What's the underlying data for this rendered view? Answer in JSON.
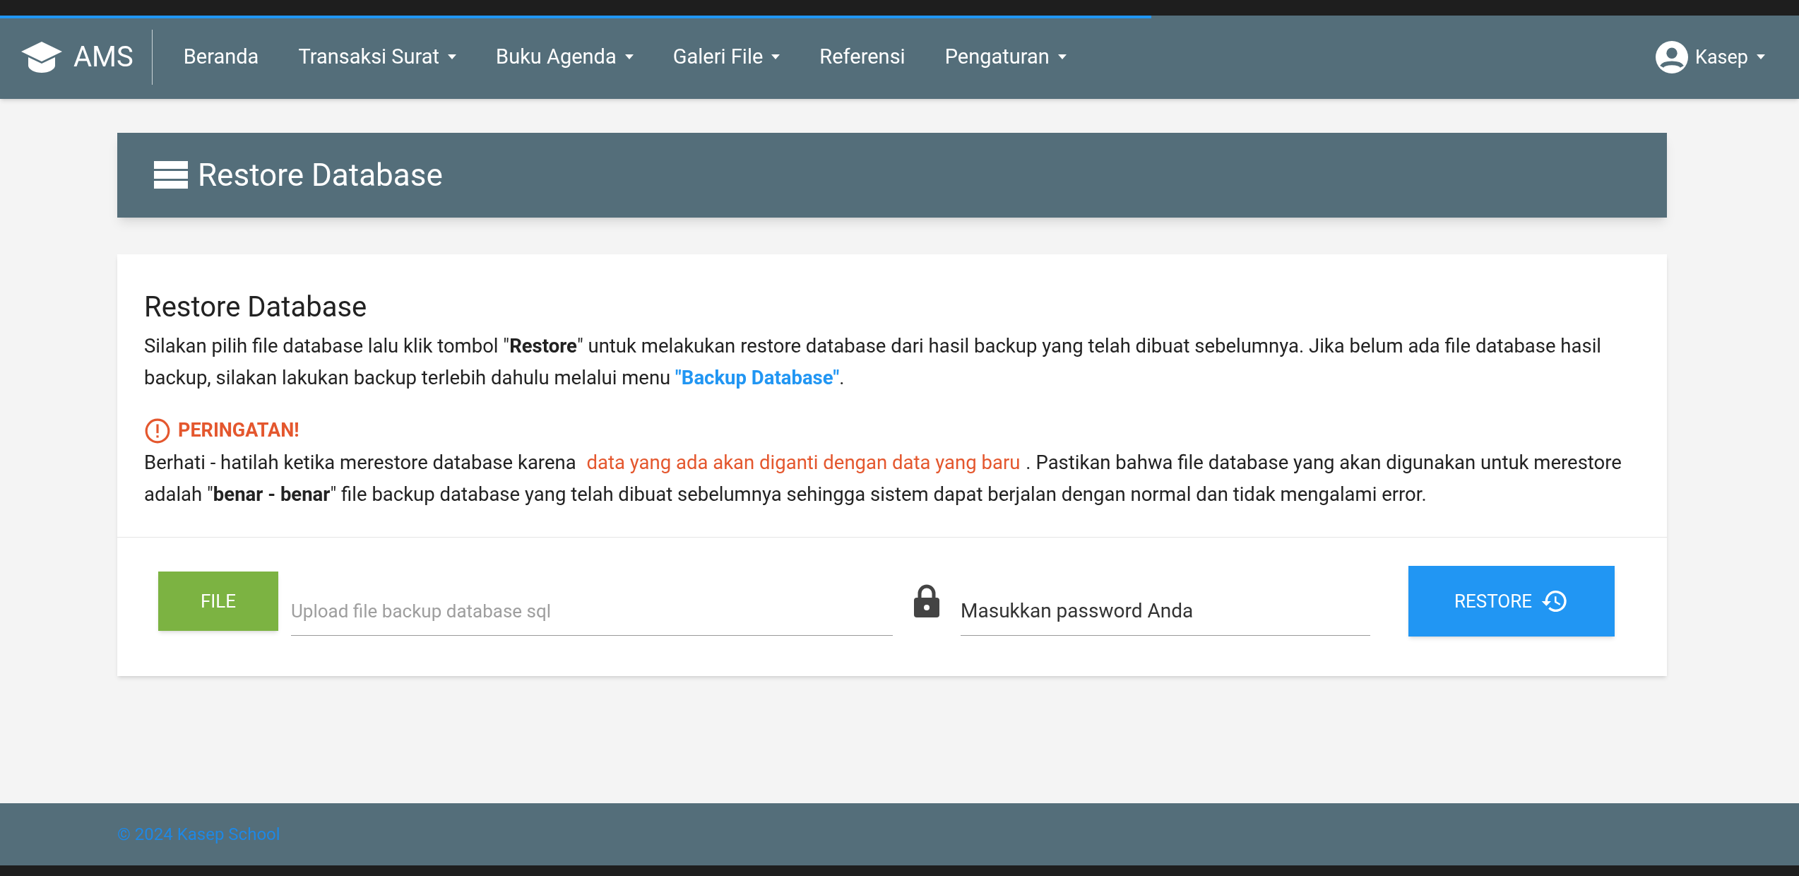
{
  "navbar": {
    "brand": "AMS",
    "items": [
      {
        "label": "Beranda",
        "dropdown": false
      },
      {
        "label": "Transaksi Surat",
        "dropdown": true
      },
      {
        "label": "Buku Agenda",
        "dropdown": true
      },
      {
        "label": "Galeri File",
        "dropdown": true
      },
      {
        "label": "Referensi",
        "dropdown": false
      },
      {
        "label": "Pengaturan",
        "dropdown": true
      }
    ],
    "user": "Kasep",
    "loading": {
      "level": 0.64
    }
  },
  "page_header": {
    "title": "Restore Database"
  },
  "card": {
    "title": "Restore Database",
    "intro": "Silakan pilih file database lalu klik tombol \"**Restore**\" untuk melakukan restore database dari hasil backup yang telah dibuat sebelumnya. Jika belum ada file database hasil backup, silakan lakukan backup terlebih dahulu melalui menu ",
    "intro_link": "\"Backup Database\"",
    "intro_end": ".",
    "warning_title": "PERINGATAN!",
    "warning_before": "Berhati - hatilah ketika merestore database karena ",
    "warning_highlight": "data yang ada akan diganti dengan data yang baru",
    "warning_after": ". Pastikan bahwa file database yang akan digunakan untuk merestore adalah \"**benar - benar**\" file backup database yang telah dibuat sebelumnya sehingga sistem dapat berjalan dengan normal dan tidak mengalami error.",
    "file_button": "FILE",
    "file_placeholder": "Upload file backup database sql",
    "password_placeholder": "Masukkan password Anda",
    "restore_button": "RESTORE"
  },
  "footer": {
    "text": "© 2024 Kasep School"
  }
}
